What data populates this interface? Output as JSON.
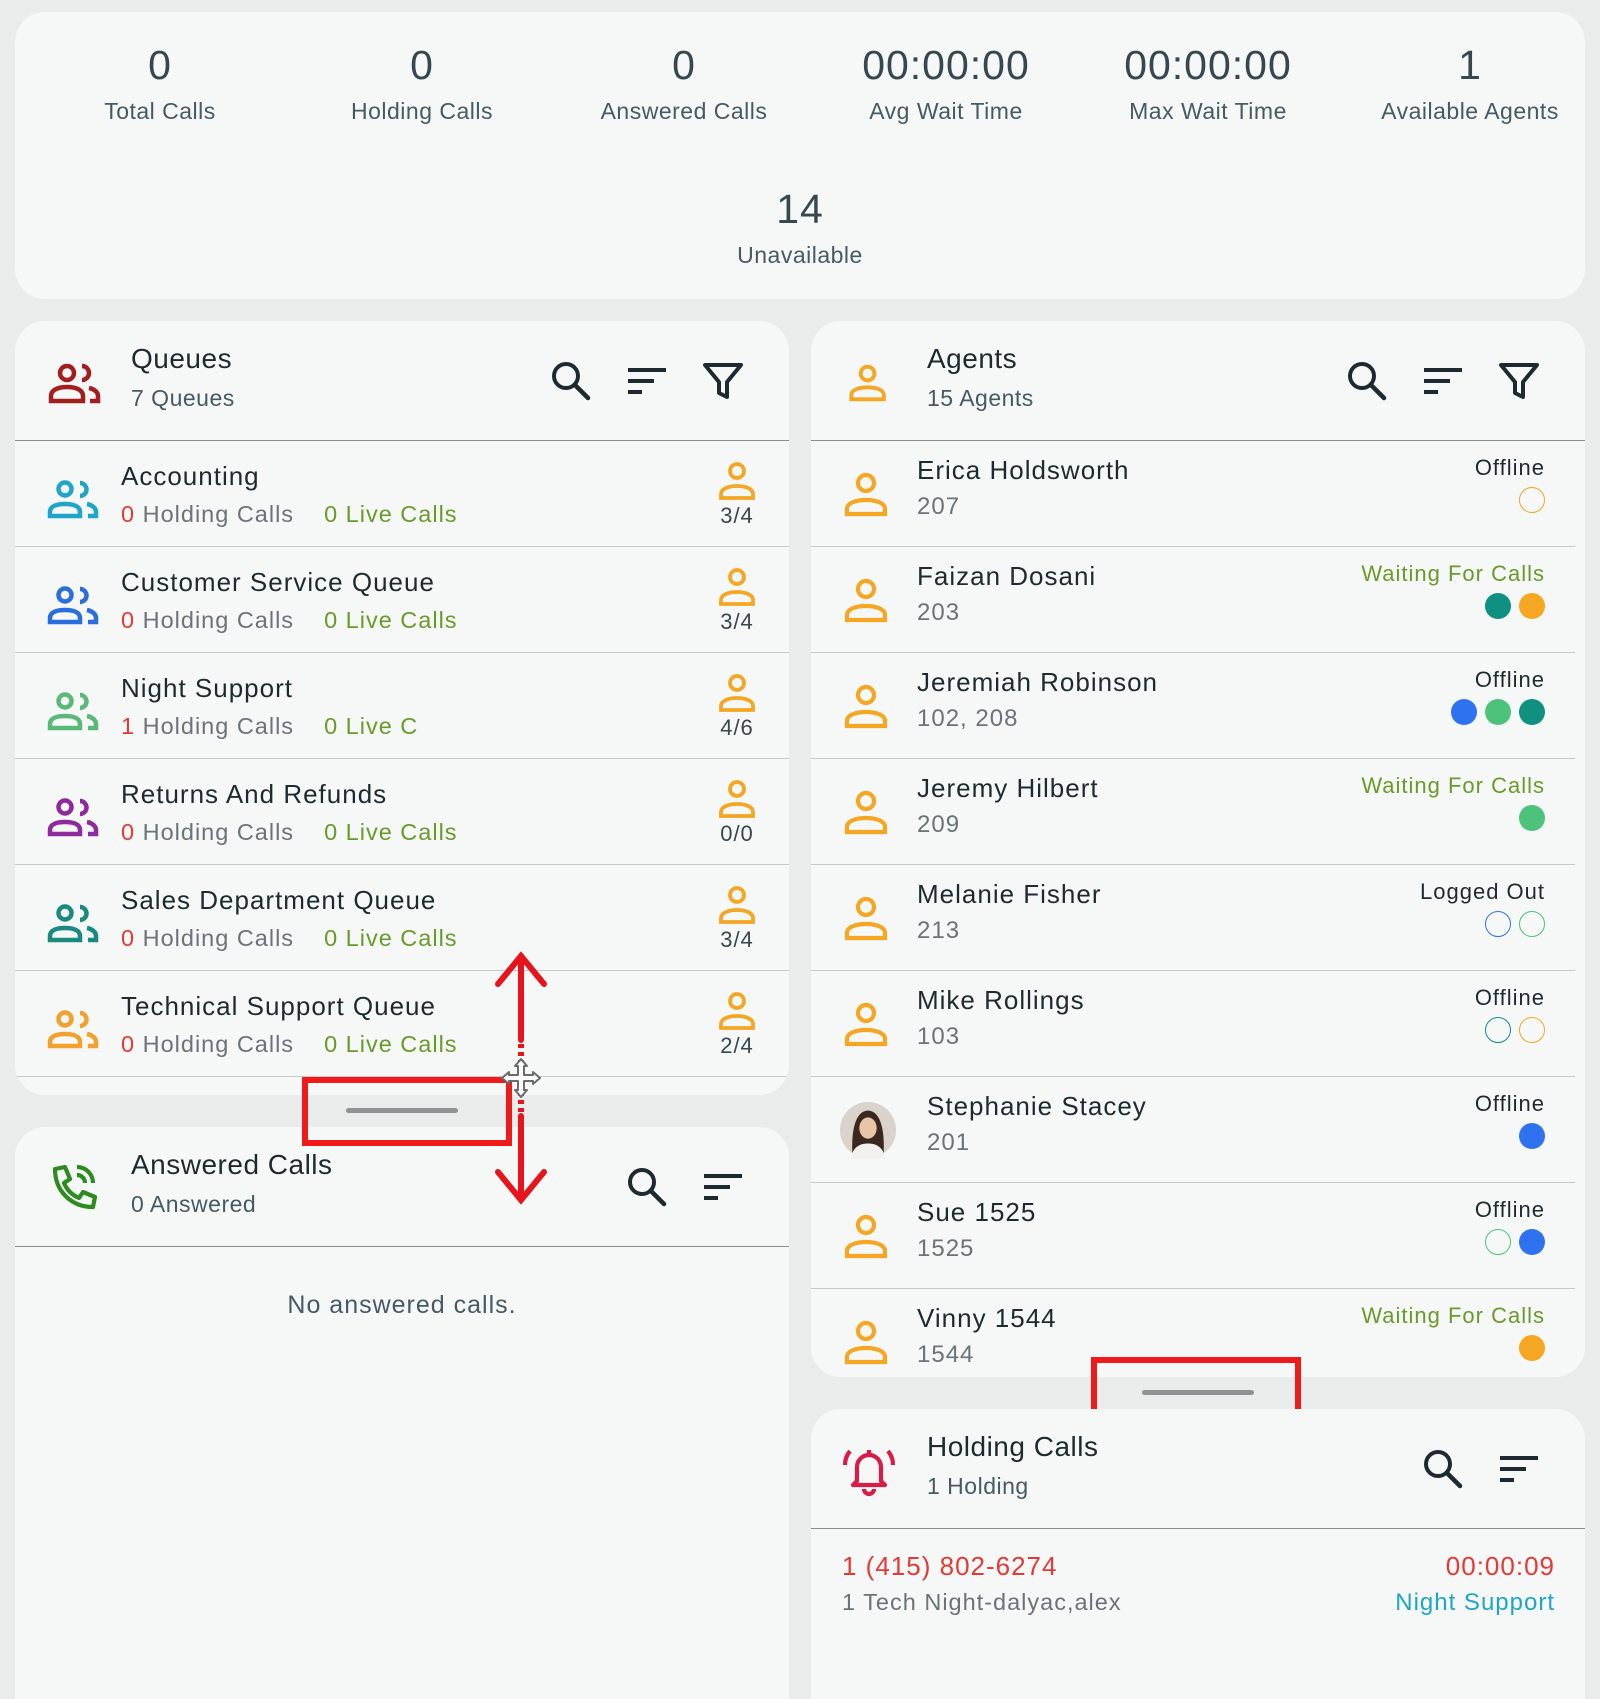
{
  "stats": [
    {
      "value": "0",
      "label": "Total Calls"
    },
    {
      "value": "0",
      "label": "Holding Calls"
    },
    {
      "value": "0",
      "label": "Answered Calls"
    },
    {
      "value": "00:00:00",
      "label": "Avg Wait Time"
    },
    {
      "value": "00:00:00",
      "label": "Max Wait Time"
    },
    {
      "value": "1",
      "label": "Available Agents"
    },
    {
      "value": "14",
      "label": "Unavailable"
    }
  ],
  "queues_panel": {
    "title": "Queues",
    "subtitle": "7 Queues",
    "icon": "people-icon",
    "icon_color": "#a31f1f",
    "queues": [
      {
        "name": "Accounting",
        "holding": "0",
        "holding_label": "Holding Calls",
        "live": "0",
        "live_label": "Live Calls",
        "agents": "3/4",
        "icon_color": "#1fa5c9"
      },
      {
        "name": "Customer Service Queue",
        "holding": "0",
        "holding_label": "Holding Calls",
        "live": "0",
        "live_label": "Live Calls",
        "agents": "3/4",
        "icon_color": "#2a6ddc"
      },
      {
        "name": "Night Support",
        "holding": "1",
        "holding_label": "Holding Calls",
        "live": "0",
        "live_label": "Live C",
        "agents": "4/6",
        "icon_color": "#5bb978"
      },
      {
        "name": "Returns And Refunds",
        "holding": "0",
        "holding_label": "Holding Calls",
        "live": "0",
        "live_label": "Live Calls",
        "agents": "0/0",
        "icon_color": "#8e2a9e"
      },
      {
        "name": "Sales Department Queue",
        "holding": "0",
        "holding_label": "Holding Calls",
        "live": "0",
        "live_label": "Live Calls",
        "agents": "3/4",
        "icon_color": "#1a8a80"
      },
      {
        "name": "Technical Support Queue",
        "holding": "0",
        "holding_label": "Holding Calls",
        "live": "0",
        "live_label": "Live Calls",
        "agents": "2/4",
        "icon_color": "#f2a12c"
      }
    ]
  },
  "answered_panel": {
    "title": "Answered Calls",
    "subtitle": "0 Answered",
    "icon": "phone-call-icon",
    "icon_color": "#2e8b1f",
    "empty_message": "No answered calls."
  },
  "agents_panel": {
    "title": "Agents",
    "subtitle": "15 Agents",
    "icon": "person-icon",
    "icon_color": "#f5a623",
    "agents": [
      {
        "name": "Erica Holdsworth",
        "ext": "207",
        "status": "Offline",
        "waiting": false,
        "avatar": "person-icon",
        "dots": [
          {
            "color": "#f5a623",
            "filled": false
          }
        ]
      },
      {
        "name": "Faizan Dosani",
        "ext": "203",
        "status": "Waiting For Calls",
        "waiting": true,
        "avatar": "person-icon",
        "dots": [
          {
            "color": "#0f9080",
            "filled": true
          },
          {
            "color": "#f5a623",
            "filled": true
          }
        ]
      },
      {
        "name": "Jeremiah Robinson",
        "ext": "102, 208",
        "status": "Offline",
        "waiting": false,
        "avatar": "person-icon",
        "dots": [
          {
            "color": "#2f72f0",
            "filled": true
          },
          {
            "color": "#4cc27a",
            "filled": true
          },
          {
            "color": "#0f9080",
            "filled": true
          }
        ]
      },
      {
        "name": "Jeremy Hilbert",
        "ext": "209",
        "status": "Waiting For Calls",
        "waiting": true,
        "avatar": "person-icon",
        "dots": [
          {
            "color": "#4cc27a",
            "filled": true
          }
        ]
      },
      {
        "name": "Melanie Fisher",
        "ext": "213",
        "status": "Logged Out",
        "waiting": false,
        "avatar": "person-icon",
        "dots": [
          {
            "color": "#2f72f0",
            "filled": false
          },
          {
            "color": "#4cc27a",
            "filled": false
          }
        ]
      },
      {
        "name": "Mike Rollings",
        "ext": "103",
        "status": "Offline",
        "waiting": false,
        "avatar": "person-icon",
        "dots": [
          {
            "color": "#0f9080",
            "filled": false
          },
          {
            "color": "#f5a623",
            "filled": false
          }
        ]
      },
      {
        "name": "Stephanie Stacey",
        "ext": "201",
        "status": "Offline",
        "waiting": false,
        "avatar": "photo-avatar",
        "dots": [
          {
            "color": "#2f72f0",
            "filled": true
          }
        ]
      },
      {
        "name": "Sue 1525",
        "ext": "1525",
        "status": "Offline",
        "waiting": false,
        "avatar": "person-icon",
        "dots": [
          {
            "color": "#4cc27a",
            "filled": false
          },
          {
            "color": "#2f72f0",
            "filled": true
          }
        ]
      },
      {
        "name": "Vinny 1544",
        "ext": "1544",
        "status": "Waiting For Calls",
        "waiting": true,
        "avatar": "person-icon",
        "dots": [
          {
            "color": "#f5a623",
            "filled": true
          }
        ]
      }
    ]
  },
  "holding_panel": {
    "title": "Holding Calls",
    "subtitle": "1 Holding",
    "icon": "bell-icon",
    "icon_color": "#d81b47",
    "calls": [
      {
        "number": "1 (415) 802-6274",
        "caller": "1 Tech Night-dalyac,alex",
        "wait": "00:00:09",
        "queue": "Night Support"
      }
    ]
  },
  "colors": {
    "accent_red": "#ef1a1a",
    "holding_red": "#e53935",
    "live_green": "#6a9a2a",
    "queue_link": "#1fa5c9"
  }
}
